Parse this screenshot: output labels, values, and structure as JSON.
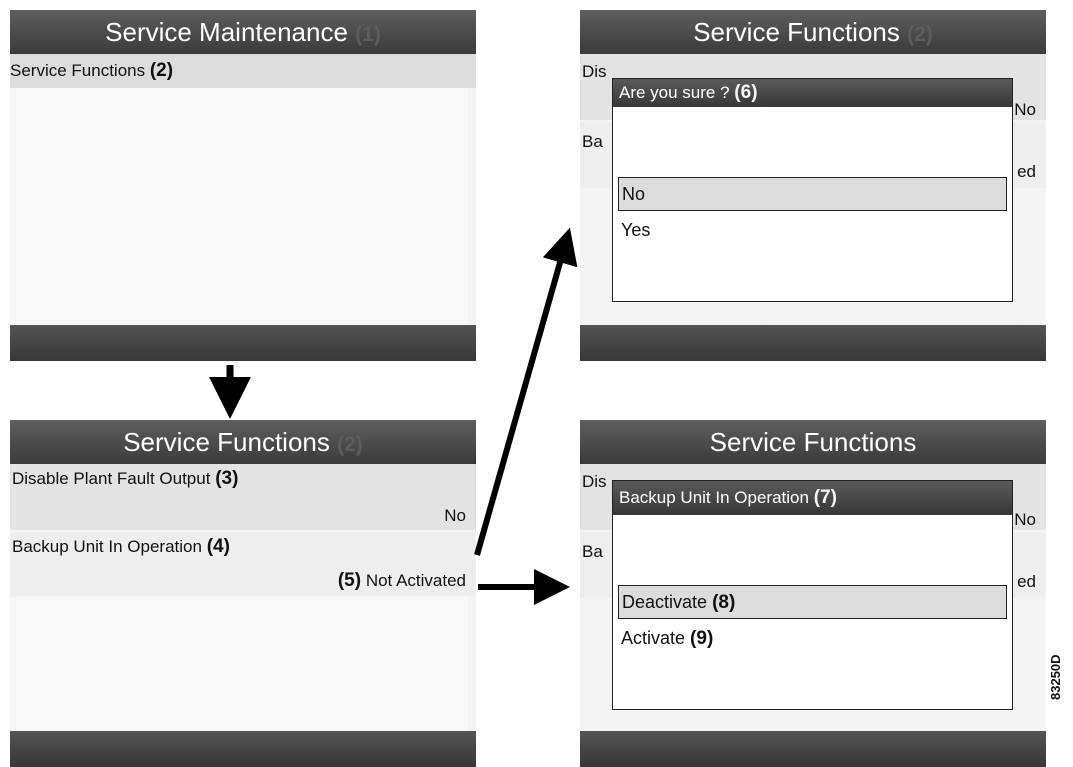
{
  "panel_maintenance": {
    "title": "Service Maintenance",
    "title_num": "(1)",
    "row_label": "Service Functions",
    "row_num": "(2)"
  },
  "panel_functions": {
    "title": "Service Functions",
    "title_num": "(2)",
    "row1_label": "Disable Plant Fault Output",
    "row1_num": "(3)",
    "row1_value": "No",
    "row2_label": "Backup Unit In Operation",
    "row2_num": "(4)",
    "row2_value_num": "(5)",
    "row2_value": "Not Activated"
  },
  "panel_confirm": {
    "title": "Service Functions",
    "title_num": "(2)",
    "behind_row1": "Dis",
    "behind_row1_right": "No",
    "behind_row2": "Ba",
    "behind_row2_right": "ed",
    "dialog_title": "Are you sure ?",
    "dialog_num": "(6)",
    "options": [
      "No",
      "Yes"
    ],
    "selected_option": "No"
  },
  "panel_backup": {
    "title": "Service Functions",
    "behind_row1": "Dis",
    "behind_row1_right": "No",
    "behind_row2": "Ba",
    "behind_row2_right": "ed",
    "dialog_title": "Backup Unit In Operation",
    "dialog_num": "(7)",
    "option1": "Deactivate",
    "option1_num": "(8)",
    "option2": "Activate",
    "option2_num": "(9)",
    "selected_option": "Deactivate"
  },
  "figure_code": "83250D"
}
